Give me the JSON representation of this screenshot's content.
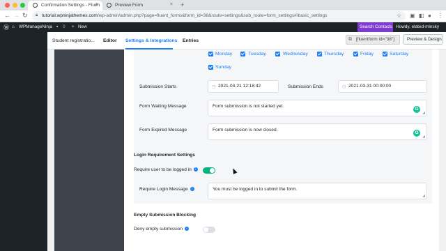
{
  "browser": {
    "tabs": [
      {
        "title": "Confirmation Settings - Fluen",
        "active": true
      },
      {
        "title": "Preview Form",
        "active": false
      }
    ],
    "new_tab": "+",
    "url_host": "tutorial.wpninjathemes.com",
    "url_path": "/wp-admin/admin.php?page=fluent_forms&form_id=38&route=settings&sub_route=form_settings#/basic_settings",
    "nav_back": "←",
    "nav_forward": "→",
    "nav_reload": "↻"
  },
  "admin_bar": {
    "site_name": "WPManageNinja",
    "comments_count": "0",
    "new_label": "New",
    "search_contacts": "Search Contacts",
    "howdy": "Howdy, elated-minsky"
  },
  "topnav": {
    "tabs": [
      "Student registratio...",
      "Editor",
      "Settings & Integrations",
      "Entries"
    ],
    "active_tab": "Settings & Integrations",
    "shortcode": "[fluentform id=\"38\"]",
    "preview_button": "Preview & Design"
  },
  "schedule": {
    "days": [
      "Monday",
      "Tuesday",
      "Wednesday",
      "Thursday",
      "Friday",
      "Saturday",
      "Sunday"
    ],
    "submission_starts_label": "Submission Starts",
    "submission_starts_value": "2021-03-21 12:18:42",
    "submission_ends_label": "Submission Ends",
    "submission_ends_value": "2021-03-31 00:00:00",
    "waiting_label": "Form Waiting Message",
    "waiting_value": "Form submission is not started yet.",
    "expired_label": "Form Expired Message",
    "expired_value": "Form submission is now closed."
  },
  "login": {
    "section_title": "Login Requirement Settings",
    "require_label": "Require user to be logged in",
    "require_enabled": true,
    "message_label": "Require Login Message",
    "message_value": "You must be logged in to submit the form."
  },
  "empty_blocking": {
    "section_title": "Empty Submission Blocking",
    "deny_label": "Deny empty submission",
    "deny_enabled": false
  },
  "colors": {
    "accent": "#1a7efb",
    "toggle_on": "#00b27f",
    "admin_bar": "#1d2327",
    "search_btn": "#7e3bd0"
  }
}
